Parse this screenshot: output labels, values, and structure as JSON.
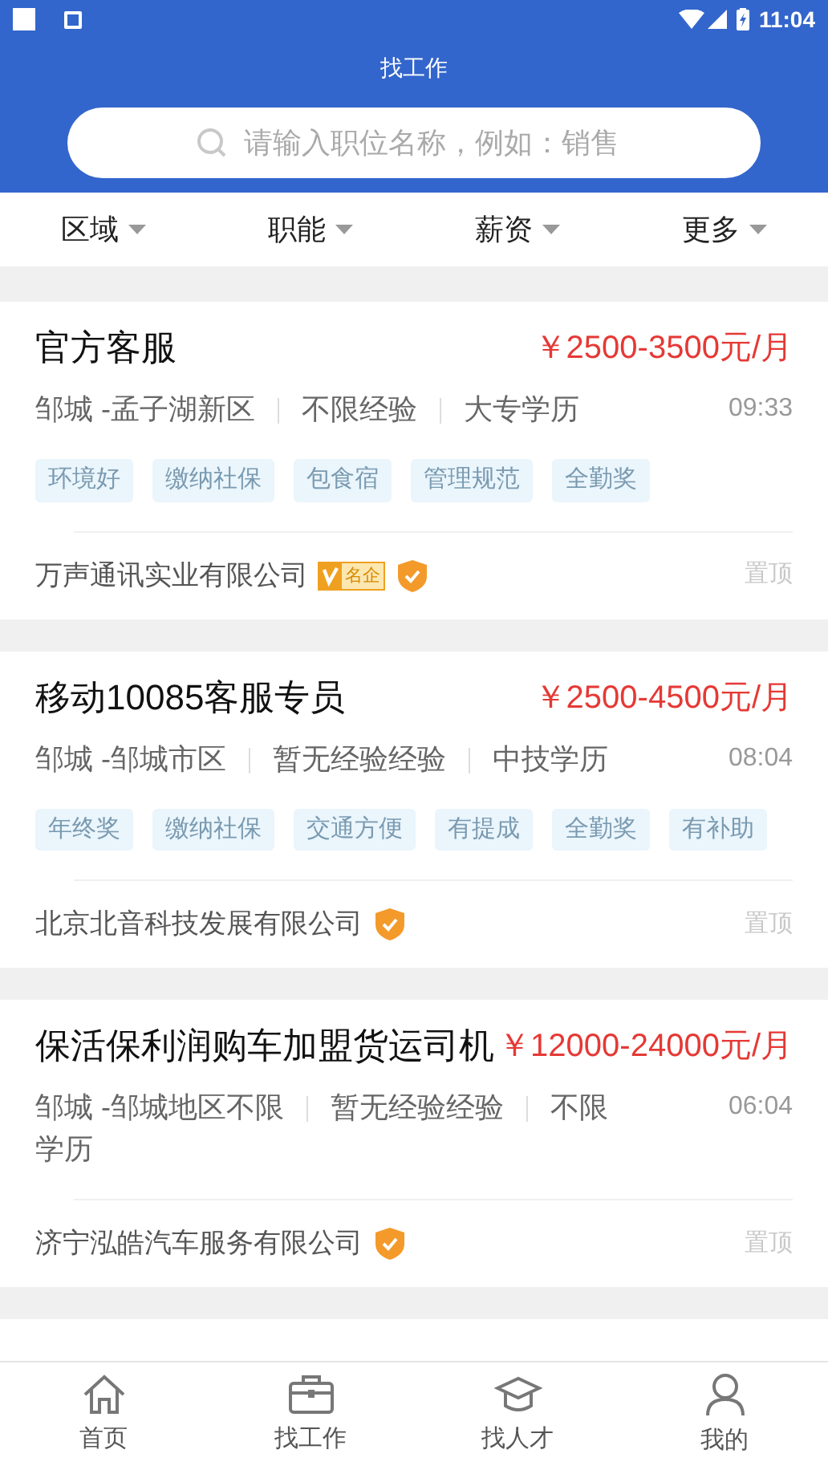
{
  "status_bar": {
    "time": "11:04"
  },
  "header": {
    "title": "找工作"
  },
  "search": {
    "placeholder": "请输入职位名称，例如：销售"
  },
  "filters": [
    {
      "label": "区域"
    },
    {
      "label": "职能"
    },
    {
      "label": "薪资"
    },
    {
      "label": "更多"
    }
  ],
  "jobs": [
    {
      "title": "官方客服",
      "salary": "￥2500-3500元/月",
      "meta": [
        "邹城 -孟子湖新区",
        "不限经验",
        "大专学历"
      ],
      "time": "09:33",
      "tags": [
        "环境好",
        "缴纳社保",
        "包食宿",
        "管理规范",
        "全勤奖"
      ],
      "company": "万声通讯实业有限公司",
      "badge": "名企",
      "verified": true,
      "pin": "置顶"
    },
    {
      "title": "移动10085客服专员",
      "salary": "￥2500-4500元/月",
      "meta": [
        "邹城 -邹城市区",
        "暂无经验经验",
        "中技学历"
      ],
      "time": "08:04",
      "tags": [
        "年终奖",
        "缴纳社保",
        "交通方便",
        "有提成",
        "全勤奖",
        "有补助"
      ],
      "company": "北京北音科技发展有限公司",
      "verified": true,
      "pin": "置顶"
    },
    {
      "title": "保活保利润购车加盟货运司机",
      "salary": "￥12000-24000元/月",
      "meta": [
        "邹城 -邹城地区不限",
        "暂无经验经验",
        "不限学历"
      ],
      "time": "06:04",
      "company": "济宁泓皓汽车服务有限公司",
      "verified": true,
      "pin": "置顶"
    }
  ],
  "tabs": [
    {
      "label": "首页",
      "kind": "home"
    },
    {
      "label": "找工作",
      "kind": "briefcase"
    },
    {
      "label": "找人才",
      "kind": "cap"
    },
    {
      "label": "我的",
      "kind": "person"
    }
  ]
}
